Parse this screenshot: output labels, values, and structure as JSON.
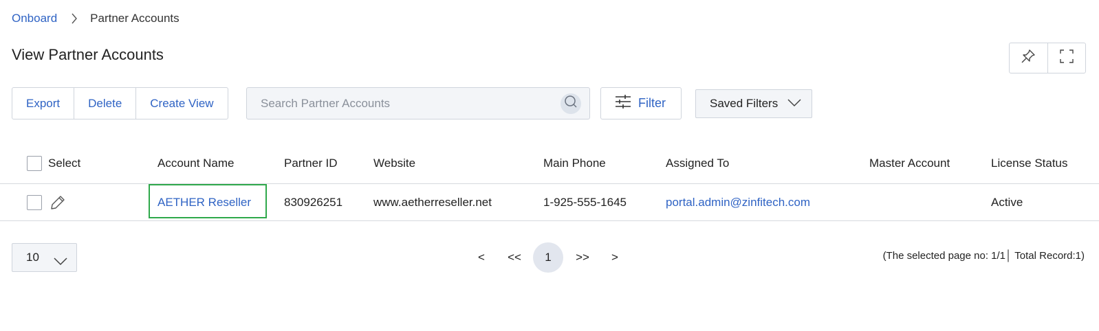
{
  "breadcrumb": {
    "root": "Onboard",
    "current": "Partner Accounts"
  },
  "page": {
    "title": "View Partner Accounts"
  },
  "toolbar": {
    "export_label": "Export",
    "delete_label": "Delete",
    "create_view_label": "Create View",
    "search_placeholder": "Search Partner Accounts",
    "filter_label": "Filter",
    "saved_filters_label": "Saved Filters"
  },
  "table": {
    "columns": {
      "select": "Select",
      "account_name": "Account Name",
      "partner_id": "Partner ID",
      "website": "Website",
      "main_phone": "Main Phone",
      "assigned_to": "Assigned To",
      "master_account": "Master Account",
      "license_status": "License Status"
    },
    "rows": [
      {
        "account_name": "AETHER Reseller",
        "partner_id": "830926251",
        "website": "www.aetherreseller.net",
        "main_phone": "1-925-555-1645",
        "assigned_to": "portal.admin@zinfitech.com",
        "master_account": "",
        "license_status": "Active"
      }
    ]
  },
  "pagination": {
    "page_size": "10",
    "prev": "<",
    "first": "<<",
    "current_page": "1",
    "last": ">>",
    "next": ">",
    "summary": "(The selected page no: 1/1│ Total Record:1)"
  },
  "colors": {
    "link": "#2f63c4",
    "highlight": "#2ea84a"
  },
  "icons": [
    "chevron-right-icon",
    "pin-icon",
    "fullscreen-icon",
    "search-icon",
    "sliders-icon",
    "chevron-down-icon",
    "pencil-icon"
  ]
}
